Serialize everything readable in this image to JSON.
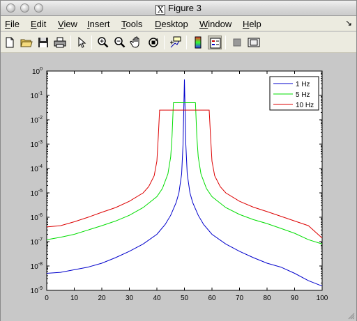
{
  "window": {
    "title": "Figure 3"
  },
  "menu": {
    "items": [
      {
        "label": "File",
        "underline": "F",
        "rest": "ile"
      },
      {
        "label": "Edit",
        "underline": "E",
        "rest": "dit"
      },
      {
        "label": "View",
        "underline": "V",
        "rest": "iew"
      },
      {
        "label": "Insert",
        "underline": "I",
        "rest": "nsert"
      },
      {
        "label": "Tools",
        "underline": "T",
        "rest": "ools"
      },
      {
        "label": "Desktop",
        "underline": "D",
        "rest": "esktop"
      },
      {
        "label": "Window",
        "underline": "W",
        "rest": "indow"
      },
      {
        "label": "Help",
        "underline": "H",
        "rest": "elp"
      }
    ],
    "overflow_glyph": "↘"
  },
  "toolbar": {
    "buttons": [
      {
        "icon": "new-file-icon"
      },
      {
        "icon": "open-folder-icon"
      },
      {
        "icon": "save-icon"
      },
      {
        "icon": "print-icon"
      },
      {
        "icon": "pointer-icon"
      },
      {
        "icon": "zoom-in-icon"
      },
      {
        "icon": "zoom-out-icon"
      },
      {
        "icon": "pan-hand-icon"
      },
      {
        "icon": "rotate-3d-icon"
      },
      {
        "icon": "data-cursor-icon"
      },
      {
        "icon": "colorbar-icon"
      },
      {
        "icon": "legend-icon",
        "pressed": true
      },
      {
        "icon": "hide-plot-tools-icon"
      },
      {
        "icon": "show-plot-tools-icon"
      }
    ]
  },
  "chart_data": {
    "type": "line",
    "title": "",
    "xlabel": "",
    "ylabel": "",
    "xlim": [
      0,
      100
    ],
    "ylim_log10": [
      -9,
      0
    ],
    "yscale": "log",
    "x_ticks": [
      "0",
      "10",
      "20",
      "30",
      "40",
      "50",
      "60",
      "70",
      "80",
      "90",
      "100"
    ],
    "y_ticks": [
      {
        "base": "10",
        "exp": "0"
      },
      {
        "base": "10",
        "exp": "-1"
      },
      {
        "base": "10",
        "exp": "-2"
      },
      {
        "base": "10",
        "exp": "-3"
      },
      {
        "base": "10",
        "exp": "-4"
      },
      {
        "base": "10",
        "exp": "-5"
      },
      {
        "base": "10",
        "exp": "-6"
      },
      {
        "base": "10",
        "exp": "-7"
      },
      {
        "base": "10",
        "exp": "-8"
      },
      {
        "base": "10",
        "exp": "-9"
      }
    ],
    "grid": false,
    "legend_position": "top-right",
    "series": [
      {
        "name": "1 Hz",
        "color": "#0000cc",
        "kind": "narrow",
        "points": [
          [
            0,
            5e-09
          ],
          [
            5,
            5.5e-09
          ],
          [
            10,
            7e-09
          ],
          [
            15,
            9e-09
          ],
          [
            20,
            1.3e-08
          ],
          [
            25,
            2.2e-08
          ],
          [
            30,
            4e-08
          ],
          [
            35,
            8e-08
          ],
          [
            40,
            2e-07
          ],
          [
            43,
            5e-07
          ],
          [
            45,
            1.2e-06
          ],
          [
            47,
            4e-06
          ],
          [
            48,
            1e-05
          ],
          [
            49,
            6e-05
          ],
          [
            49.5,
            0.001
          ],
          [
            50,
            0.45
          ],
          [
            50.5,
            0.001
          ],
          [
            51,
            6e-05
          ],
          [
            52,
            1e-05
          ],
          [
            53,
            4e-06
          ],
          [
            55,
            1.2e-06
          ],
          [
            57,
            5e-07
          ],
          [
            60,
            2e-07
          ],
          [
            65,
            8e-08
          ],
          [
            70,
            4e-08
          ],
          [
            75,
            2.2e-08
          ],
          [
            80,
            1.3e-08
          ],
          [
            85,
            9e-09
          ],
          [
            90,
            5e-09
          ],
          [
            95,
            2.5e-09
          ],
          [
            100,
            1.5e-09
          ]
        ]
      },
      {
        "name": "5 Hz",
        "color": "#00dd00",
        "kind": "mid",
        "points": [
          [
            0,
            1.2e-07
          ],
          [
            5,
            1.5e-07
          ],
          [
            10,
            2e-07
          ],
          [
            15,
            3e-07
          ],
          [
            20,
            4.5e-07
          ],
          [
            25,
            7e-07
          ],
          [
            30,
            1.2e-06
          ],
          [
            35,
            2.5e-06
          ],
          [
            40,
            7e-06
          ],
          [
            42,
            1.5e-05
          ],
          [
            44,
            6e-05
          ],
          [
            45,
            0.0003
          ],
          [
            45.5,
            0.002
          ],
          [
            46,
            0.05
          ],
          [
            54,
            0.05
          ],
          [
            54.5,
            0.002
          ],
          [
            55,
            0.0003
          ],
          [
            56,
            6e-05
          ],
          [
            58,
            1.5e-05
          ],
          [
            60,
            7e-06
          ],
          [
            65,
            2.5e-06
          ],
          [
            70,
            1.3e-06
          ],
          [
            75,
            8e-07
          ],
          [
            80,
            5.5e-07
          ],
          [
            85,
            3.5e-07
          ],
          [
            90,
            2.2e-07
          ],
          [
            95,
            1.2e-07
          ],
          [
            100,
            8e-08
          ]
        ]
      },
      {
        "name": "10 Hz",
        "color": "#dd0000",
        "kind": "wide",
        "points": [
          [
            0,
            4e-07
          ],
          [
            5,
            4.5e-07
          ],
          [
            10,
            6.5e-07
          ],
          [
            15,
            1e-06
          ],
          [
            20,
            1.6e-06
          ],
          [
            25,
            2.5e-06
          ],
          [
            30,
            4.5e-06
          ],
          [
            35,
            1e-05
          ],
          [
            37,
            1.8e-05
          ],
          [
            39,
            5e-05
          ],
          [
            40,
            0.0002
          ],
          [
            40.5,
            0.002
          ],
          [
            41,
            0.025
          ],
          [
            59,
            0.025
          ],
          [
            59.5,
            0.002
          ],
          [
            60,
            0.0002
          ],
          [
            61,
            5e-05
          ],
          [
            63,
            1.8e-05
          ],
          [
            65,
            1e-05
          ],
          [
            70,
            4.5e-06
          ],
          [
            75,
            2.6e-06
          ],
          [
            80,
            1.7e-06
          ],
          [
            85,
            1.1e-06
          ],
          [
            90,
            7e-07
          ],
          [
            95,
            4.5e-07
          ],
          [
            100,
            1.4e-07
          ]
        ]
      }
    ]
  }
}
